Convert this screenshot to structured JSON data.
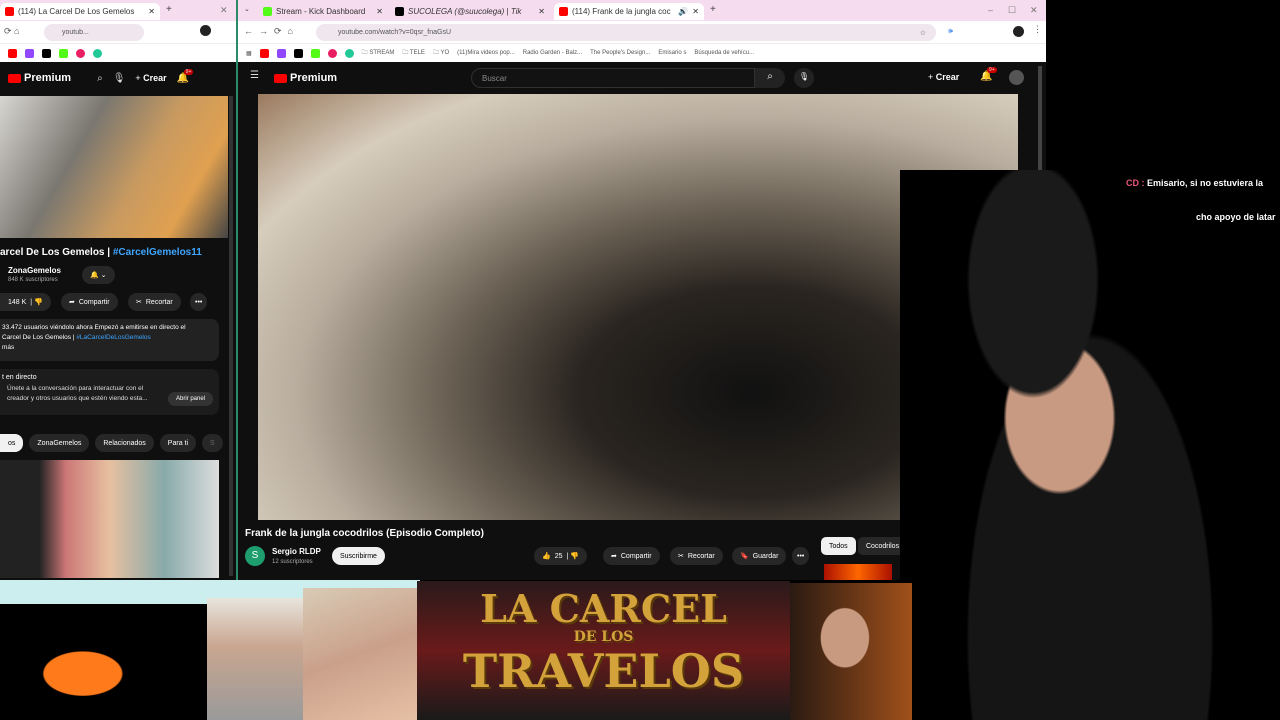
{
  "left_window": {
    "tab_title": "(114) La Carcel De Los Gemelos",
    "url": "youtub...",
    "yt_brand": "Premium",
    "create_label": "Crear",
    "notif_badge": "9+",
    "video_title_prefix": "arcel De Los Gemelos | ",
    "video_hashtag": "#CarcelGemelos11",
    "channel_name": "ZonaGemelos",
    "subscribers": "848 K suscriptores",
    "likes": "148 K",
    "share_label": "Compartir",
    "clip_label": "Recortar",
    "description_line1": "33.472 usuarios viéndolo ahora  Empezó a emitirse en directo el",
    "description_line2_prefix": "Carcel De Los Gemelos | ",
    "description_hashtag": "#LaCarcelDeLosGemelos",
    "description_more": "más",
    "chat_title": "t en directo",
    "chat_text": "Únete a la conversación para interactuar con el creador y otros usuarios que estén viendo esta...",
    "chat_button": "Abrir panel",
    "chips": [
      "os",
      "ZonaGemelos",
      "Relacionados",
      "Para ti",
      "S"
    ]
  },
  "right_window": {
    "tabs": [
      "Stream - Kick Dashboard",
      "SUCOLEGA (@suucolega) | Tik",
      "(114) Frank de la jungla coc"
    ],
    "url": "youtube.com/watch?v=0qsr_fnaGsU",
    "bookmarks": [
      "STREAM",
      "TELE",
      "YO",
      "(11)Mira videos pop...",
      "Radio Garden - Balz...",
      "The People's Design...",
      "Emisario s",
      "Búsqueda de vehícu..."
    ],
    "yt_brand": "Premium",
    "search_placeholder": "Buscar",
    "create_label": "Crear",
    "notif_badge": "9+",
    "video_title": "Frank de la jungla cocodrilos (Episodio Completo)",
    "channel_initial": "S",
    "channel_name": "Sergio RLDP",
    "subscribers": "12 suscriptores",
    "subscribe_label": "Suscribirme",
    "likes": "25",
    "share_label": "Compartir",
    "clip_label": "Recortar",
    "save_label": "Guardar",
    "chips": [
      "Todos",
      "Cocodrilos"
    ]
  },
  "chat_overlay": {
    "line1": "Emisario, si no estuviera la",
    "line2": "cho apoyo de latar",
    "user_fragment": "CD :"
  },
  "banner": {
    "line1": "LA CARCEL",
    "line2": "DE LOS",
    "line3": "TRAVELOS"
  },
  "colors": {
    "tab_bg": "#f6dcef",
    "yt_dark": "#0f0f0f",
    "yt_red": "#ff0000",
    "link_blue": "#3ea6ff",
    "gold": "#c8962e"
  }
}
